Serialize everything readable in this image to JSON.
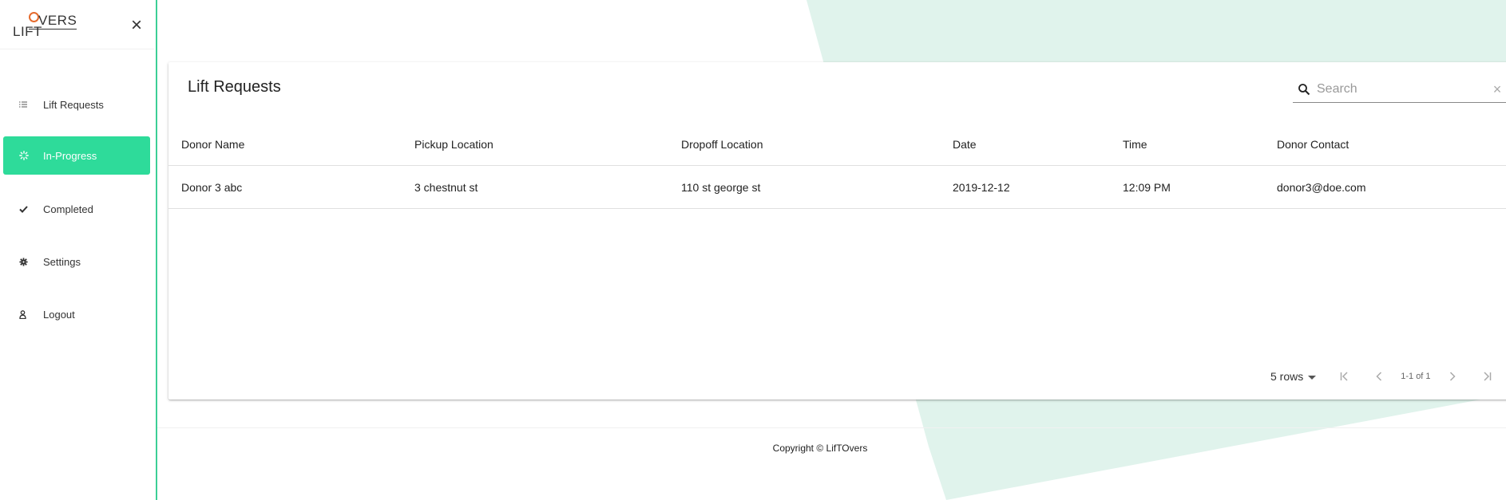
{
  "brand": {
    "logo_top": "VERS",
    "logo_bottom": "LIFT",
    "accent_color": "#2edb9a",
    "logo_accent_color": "#e56b2e"
  },
  "sidebar": {
    "close_icon": "close-icon",
    "items": [
      {
        "label": "Lift Requests",
        "icon": "list-icon",
        "active": false
      },
      {
        "label": "In-Progress",
        "icon": "spinner-icon",
        "active": true
      },
      {
        "label": "Completed",
        "icon": "check-icon",
        "active": false
      },
      {
        "label": "Settings",
        "icon": "gear-icon",
        "active": false
      },
      {
        "label": "Logout",
        "icon": "user-icon",
        "active": false
      }
    ]
  },
  "main": {
    "title": "Lift Requests",
    "search": {
      "placeholder": "Search",
      "value": ""
    },
    "table": {
      "columns": [
        "Donor Name",
        "Pickup Location",
        "Dropoff Location",
        "Date",
        "Time",
        "Donor Contact"
      ],
      "rows": [
        [
          "Donor 3 abc",
          "3 chestnut st",
          "110 st george st",
          "2019-12-12",
          "12:09 PM",
          "donor3@doe.com"
        ]
      ]
    },
    "pagination": {
      "rows_per_page": "5 rows",
      "range": "1-1 of 1"
    }
  },
  "footer": {
    "copyright": "Copyright © LifTOvers"
  }
}
